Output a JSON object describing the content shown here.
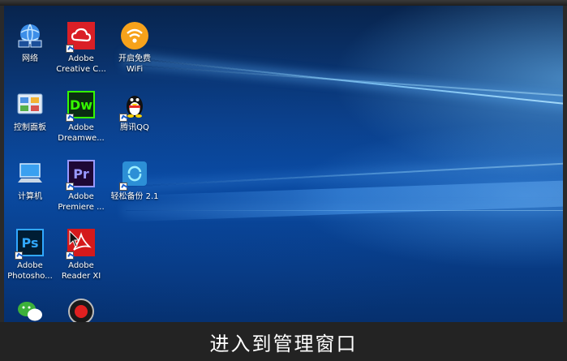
{
  "caption": "进入到管理窗口",
  "colors": {
    "wallpaper": "#0a4ca4",
    "caption_bg": "#232323",
    "adobe_cc": "#da1f26",
    "dreamweaver": "#35fa00",
    "premiere": "#9999ff",
    "photoshop": "#31a8ff",
    "acrobat": "#d4191b",
    "qq_yellow": "#ffd400",
    "wechat_green": "#3db13a"
  },
  "desktop_icons": [
    {
      "icon": "network-icon",
      "label": "网络"
    },
    {
      "icon": "adobe-creative-cloud-icon",
      "label": "Adobe\nCreative C..."
    },
    {
      "icon": "free-wifi-icon",
      "label": "开启免费\nWiFi"
    },
    {
      "icon": "control-panel-icon",
      "label": "控制面板"
    },
    {
      "icon": "dreamweaver-icon",
      "label": "Adobe\nDreamwe...",
      "glyph": "Dw"
    },
    {
      "icon": "qq-penguin-icon",
      "label": "腾讯QQ"
    },
    {
      "icon": "computer-icon",
      "label": "计算机"
    },
    {
      "icon": "premiere-icon",
      "label": "Adobe\nPremiere ...",
      "glyph": "Pr"
    },
    {
      "icon": "backup-icon",
      "label": "轻松备份 2.1"
    },
    {
      "icon": "photoshop-icon",
      "label": "Adobe\nPhotosho...",
      "glyph": "Ps"
    },
    {
      "icon": "acrobat-reader-icon",
      "label": "Adobe\nReader XI"
    },
    {
      "icon": "wechat-icon",
      "label": ""
    },
    {
      "icon": "screen-recorder-icon",
      "label": ""
    }
  ]
}
